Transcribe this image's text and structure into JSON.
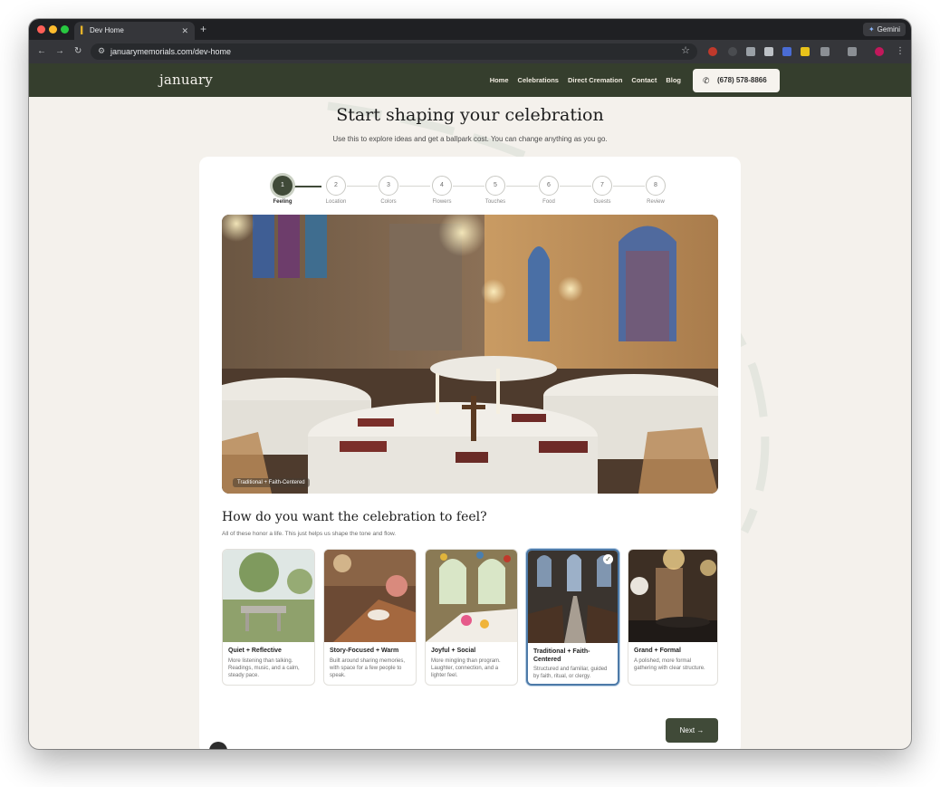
{
  "browser": {
    "tab_title": "Dev Home",
    "tab_close": "✕",
    "new_tab": "+",
    "gemini_label": "Gemini",
    "url": "januarymemorials.com/dev-home"
  },
  "site": {
    "logo": "january",
    "nav": [
      "Home",
      "Celebrations",
      "Direct Cremation",
      "Contact",
      "Blog"
    ],
    "phone": "(678) 578-8866"
  },
  "page": {
    "title": "Start shaping your celebration",
    "subtitle": "Use this to explore ideas and get a ballpark cost. You can change anything as you go."
  },
  "stepper": {
    "steps": [
      {
        "num": "1",
        "label": "Feeling"
      },
      {
        "num": "2",
        "label": "Location"
      },
      {
        "num": "3",
        "label": "Colors"
      },
      {
        "num": "4",
        "label": "Flowers"
      },
      {
        "num": "5",
        "label": "Touches"
      },
      {
        "num": "6",
        "label": "Food"
      },
      {
        "num": "7",
        "label": "Guests"
      },
      {
        "num": "8",
        "label": "Review"
      }
    ],
    "current": "Feeling"
  },
  "hero": {
    "caption": "Traditional + Faith-Centered"
  },
  "question": {
    "title": "How do you want the celebration to feel?",
    "subtitle": "All of these honor a life. This just helps us shape the tone and flow.",
    "options": [
      {
        "title": "Quiet + Reflective",
        "desc": "More listening than talking. Readings, music, and a calm, steady pace."
      },
      {
        "title": "Story-Focused + Warm",
        "desc": "Built around sharing memories, with space for a few people to speak."
      },
      {
        "title": "Joyful + Social",
        "desc": "More mingling than program. Laughter, connection, and a lighter feel."
      },
      {
        "title": "Traditional + Faith-Centered",
        "desc": "Structured and familiar, guided by faith, ritual, or clergy."
      },
      {
        "title": "Grand + Formal",
        "desc": "A polished, more formal gathering with clear structure."
      }
    ],
    "selected": "Traditional + Faith-Centered"
  },
  "actions": {
    "next": "Next →"
  },
  "colors": {
    "brand_dark": "#353e2d",
    "accent": "#404a38",
    "selected_border": "#4d7aa8"
  }
}
